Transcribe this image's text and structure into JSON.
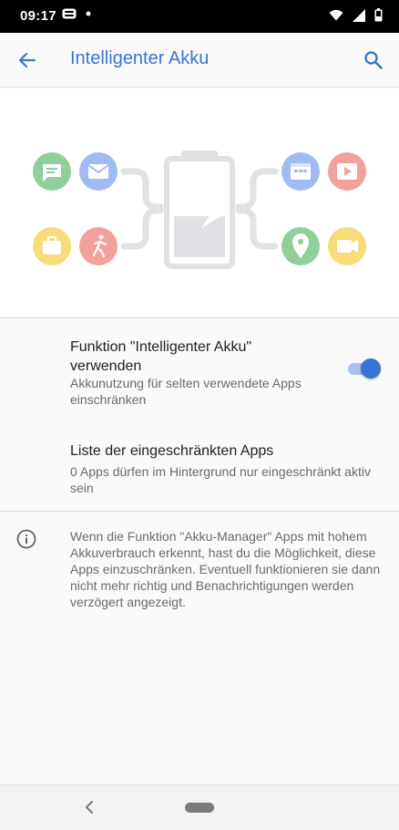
{
  "status_bar": {
    "time": "09:17",
    "left_icons": [
      "notification-icon",
      "dot-icon"
    ],
    "right_icons": [
      "wifi-icon",
      "signal-icon",
      "battery-icon"
    ]
  },
  "app_bar": {
    "title": "Intelligenter Akku",
    "back_icon": "arrow-back-icon",
    "search_icon": "search-icon"
  },
  "hero": {
    "left_app_icons": [
      "message-icon",
      "mail-icon",
      "briefcase-icon",
      "runner-icon"
    ],
    "right_app_icons": [
      "calendar-icon",
      "video-icon",
      "map-pin-icon",
      "camera-icon"
    ],
    "center_icon": "battery-illustration-icon"
  },
  "settings": {
    "smart_battery": {
      "title": "Funktion \"Intelligenter Akku\" verwenden",
      "summary": "Akkunutzung für selten verwendete Apps einschränken",
      "enabled": true
    },
    "restricted_apps": {
      "title": "Liste der eingeschränkten Apps",
      "summary": "0 Apps dürfen im Hintergrund nur eingeschränkt aktiv sein"
    }
  },
  "info": {
    "icon": "info-icon",
    "text": "Wenn die Funktion \"Akku-Manager\" Apps mit hohem Akkuverbrauch erkennt, hast du die Möglichkeit, diese Apps einzuschränken. Eventuell funktionieren sie dann nicht mehr richtig und Benachrichtigungen werden verzögert angezeigt."
  },
  "nav_bar": {
    "back_icon": "nav-back-icon",
    "home_icon": "home-pill-icon"
  },
  "colors": {
    "accent": "#3a73d6",
    "green": "#8fcf9a",
    "blue": "#9fbcf0",
    "yellow": "#f7dc7a",
    "red": "#f2a09a"
  }
}
